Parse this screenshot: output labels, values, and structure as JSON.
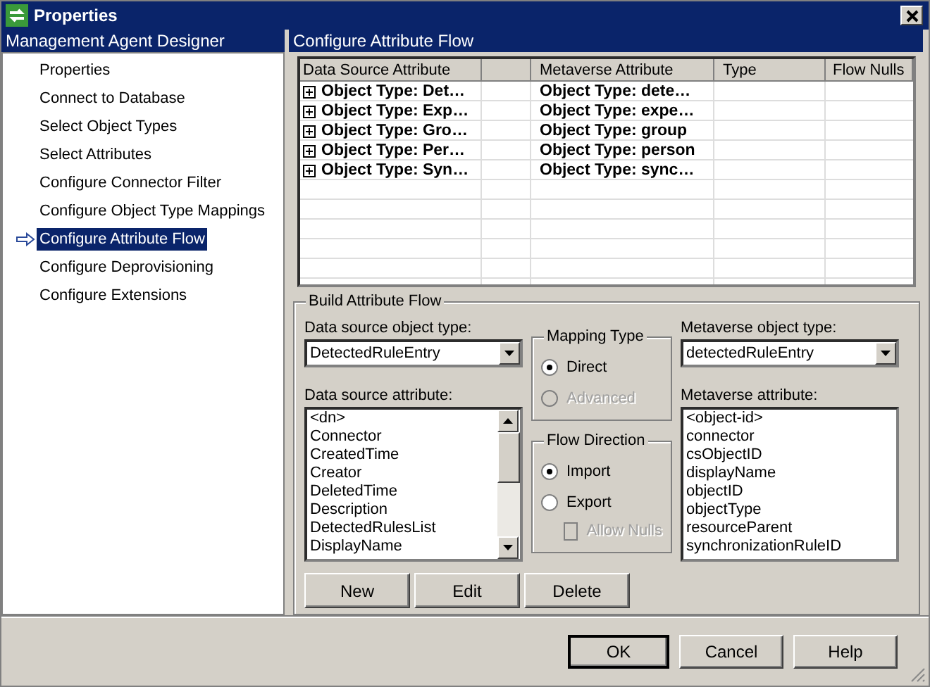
{
  "window": {
    "title": "Properties"
  },
  "sidebar": {
    "title": "Management Agent Designer",
    "items": [
      {
        "label": "Properties",
        "selected": false
      },
      {
        "label": "Connect to Database",
        "selected": false
      },
      {
        "label": "Select Object Types",
        "selected": false
      },
      {
        "label": "Select Attributes",
        "selected": false
      },
      {
        "label": "Configure Connector Filter",
        "selected": false
      },
      {
        "label": "Configure Object Type Mappings",
        "selected": false
      },
      {
        "label": "Configure Attribute Flow",
        "selected": true
      },
      {
        "label": "Configure Deprovisioning",
        "selected": false
      },
      {
        "label": "Configure Extensions",
        "selected": false
      }
    ]
  },
  "panel": {
    "title": "Configure Attribute Flow"
  },
  "table": {
    "columns": [
      "Data Source Attribute",
      "Metaverse Attribute",
      "Type",
      "Flow Nulls"
    ],
    "rows": [
      {
        "source": "Object Type: Det…",
        "metaverse": "Object Type: dete…"
      },
      {
        "source": "Object Type: Exp…",
        "metaverse": "Object Type: expe…"
      },
      {
        "source": "Object Type: Gro…",
        "metaverse": "Object Type: group"
      },
      {
        "source": "Object Type: Per…",
        "metaverse": "Object Type: person"
      },
      {
        "source": "Object Type: Syn…",
        "metaverse": "Object Type: sync…"
      }
    ]
  },
  "build": {
    "title": "Build Attribute Flow",
    "source_type_label": "Data source object type:",
    "source_type": "DetectedRuleEntry",
    "source_attr_label": "Data source attribute:",
    "source_attrs": [
      "<dn>",
      "Connector",
      "CreatedTime",
      "Creator",
      "DeletedTime",
      "Description",
      "DetectedRulesList",
      "DisplayName"
    ],
    "mapping_type": {
      "title": "Mapping Type",
      "options": [
        {
          "label": "Direct",
          "selected": true,
          "disabled": false
        },
        {
          "label": "Advanced",
          "selected": false,
          "disabled": true
        }
      ]
    },
    "flow_direction": {
      "title": "Flow Direction",
      "options": [
        {
          "label": "Import",
          "selected": true,
          "disabled": false
        },
        {
          "label": "Export",
          "selected": false,
          "disabled": false
        }
      ],
      "allow_nulls": {
        "label": "Allow Nulls",
        "checked": false,
        "disabled": true
      }
    },
    "mv_type_label": "Metaverse object type:",
    "mv_type": "detectedRuleEntry",
    "mv_attr_label": "Metaverse attribute:",
    "mv_attrs": [
      "<object-id>",
      "connector",
      "csObjectID",
      "displayName",
      "objectID",
      "objectType",
      "resourceParent",
      "synchronizationRuleID"
    ],
    "buttons": [
      "New",
      "Edit",
      "Delete"
    ]
  },
  "buttons": [
    "OK",
    "Cancel",
    "Help"
  ]
}
